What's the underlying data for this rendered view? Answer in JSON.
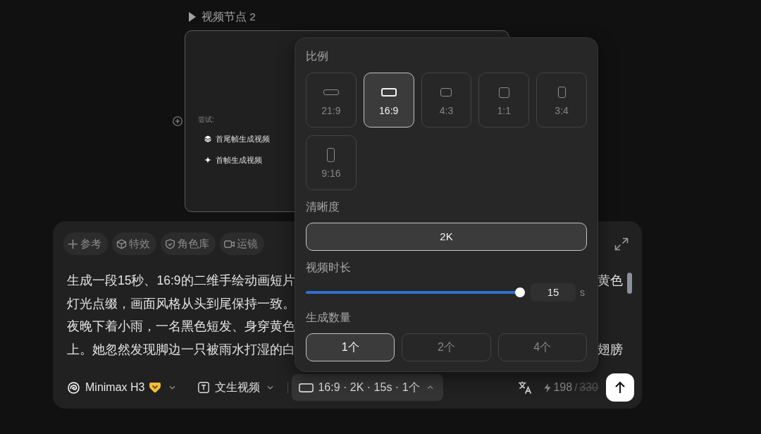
{
  "node": {
    "title": "视频节点 2",
    "hint": "尝试:",
    "suggestions": [
      {
        "label": "首尾帧生成视频"
      },
      {
        "label": "首帧生成视频"
      }
    ]
  },
  "composer": {
    "tools": [
      {
        "label": "参考"
      },
      {
        "label": "特效"
      },
      {
        "label": "角色库"
      },
      {
        "label": "运镜"
      }
    ],
    "prompt_lines": [
      {
        "left": "生成一段15秒、16:9的二维手绘动画短片",
        "right": "黄色"
      },
      {
        "left": "灯光点缀，画面风格从头到尾保持一致。"
      },
      {
        "left": "夜晚下着小雨，一名黑色短发、身穿黄色"
      },
      {
        "left": "上。她忽然发现脚边一只被雨水打湿的白",
        "right": "翅膀"
      }
    ],
    "model": {
      "name": "Minimax H3"
    },
    "mode": {
      "label": "文生视频"
    },
    "settings_button": {
      "label": "16:9 · 2K · 15s · 1个",
      "expanded": true
    },
    "credits": {
      "current": "198",
      "separator": "/",
      "previous": "330"
    }
  },
  "popup": {
    "ratio": {
      "title": "比例",
      "options": [
        {
          "label": "21:9",
          "selected": false
        },
        {
          "label": "16:9",
          "selected": true
        },
        {
          "label": "4:3",
          "selected": false
        },
        {
          "label": "1:1",
          "selected": false
        },
        {
          "label": "3:4",
          "selected": false
        },
        {
          "label": "9:16",
          "selected": false
        }
      ]
    },
    "resolution": {
      "title": "清晰度",
      "options": [
        {
          "label": "2K",
          "selected": true
        }
      ]
    },
    "duration": {
      "title": "视频时长",
      "level": 1,
      "value": "15",
      "unit": "s"
    },
    "count": {
      "title": "生成数量",
      "options": [
        {
          "label": "1个",
          "selected": true
        },
        {
          "label": "2个",
          "selected": false
        },
        {
          "label": "4个",
          "selected": false
        }
      ]
    }
  }
}
